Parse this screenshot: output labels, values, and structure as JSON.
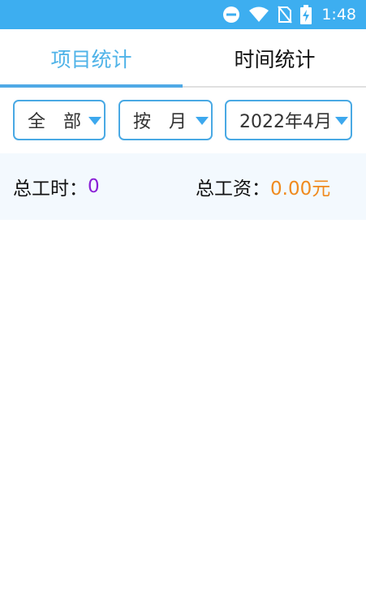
{
  "status_bar": {
    "time": "1:48",
    "color": "#3DAEF0"
  },
  "tabs": [
    {
      "label": "项目统计",
      "active": true
    },
    {
      "label": "时间统计",
      "active": false
    }
  ],
  "filters": {
    "scope": "全　部",
    "period": "按　月",
    "date": "2022年4月"
  },
  "summary": {
    "hours_label": "总工时：",
    "hours_value": "0",
    "wage_label": "总工资：",
    "wage_value": "0.00元"
  }
}
